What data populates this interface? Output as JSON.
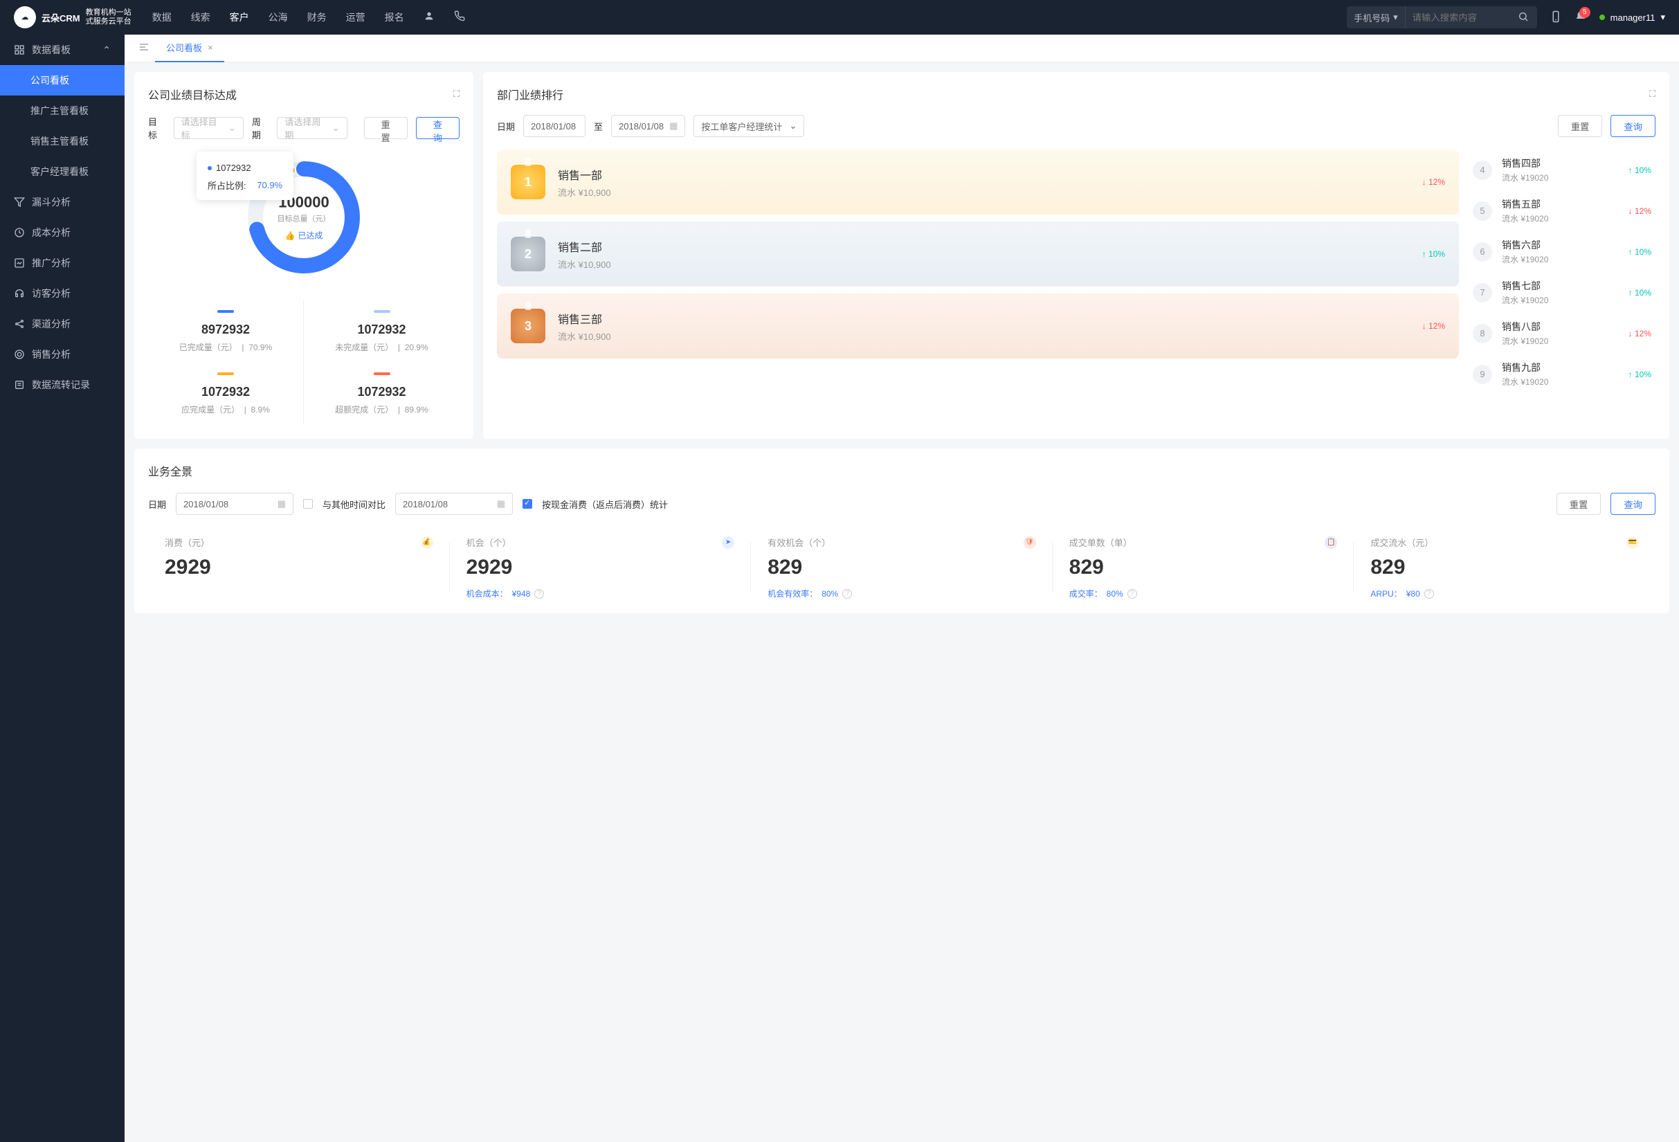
{
  "header": {
    "logo_main": "云朵CRM",
    "logo_sub1": "教育机构一站",
    "logo_sub2": "式服务云平台",
    "nav": [
      "数据",
      "线索",
      "客户",
      "公海",
      "财务",
      "运营",
      "报名"
    ],
    "nav_active": 2,
    "search_type": "手机号码",
    "search_placeholder": "请输入搜索内容",
    "notif_count": "5",
    "username": "manager11"
  },
  "sidebar": {
    "items": [
      {
        "label": "数据看板",
        "expandable": true,
        "expanded": true,
        "subs": [
          {
            "label": "公司看板",
            "active": true
          },
          {
            "label": "推广主管看板"
          },
          {
            "label": "销售主管看板"
          },
          {
            "label": "客户经理看板"
          }
        ]
      },
      {
        "label": "漏斗分析"
      },
      {
        "label": "成本分析"
      },
      {
        "label": "推广分析"
      },
      {
        "label": "访客分析"
      },
      {
        "label": "渠道分析"
      },
      {
        "label": "销售分析"
      },
      {
        "label": "数据流转记录"
      }
    ]
  },
  "tabs": {
    "active": "公司看板"
  },
  "goal": {
    "title": "公司业绩目标达成",
    "target_label": "目标",
    "target_placeholder": "请选择目标",
    "period_label": "周期",
    "period_placeholder": "请选择周期",
    "reset": "重置",
    "query": "查询",
    "tooltip_val": "1072932",
    "tooltip_ratio_lbl": "所占比例:",
    "tooltip_ratio_val": "70.9%",
    "center_val": "100000",
    "center_lbl": "目标总量（元）",
    "center_badge": "已达成",
    "stats": [
      {
        "color": "#3a7afe",
        "val": "8972932",
        "lbl": "已完成量（元）",
        "pct": "70.9%"
      },
      {
        "color": "#a8c8ff",
        "val": "1072932",
        "lbl": "未完成量（元）",
        "pct": "20.9%"
      },
      {
        "color": "#ffb020",
        "val": "1072932",
        "lbl": "应完成量（元）",
        "pct": "8.9%"
      },
      {
        "color": "#ff6b4d",
        "val": "1072932",
        "lbl": "超额完成（元）",
        "pct": "89.9%"
      }
    ]
  },
  "ranking": {
    "title": "部门业绩排行",
    "date_label": "日期",
    "date_from": "2018/01/08",
    "date_to": "2018/01/08",
    "date_sep": "至",
    "mode": "按工单客户经理统计",
    "reset": "重置",
    "query": "查询",
    "top": [
      {
        "medal": "gold",
        "num": "1",
        "name": "销售一部",
        "sub": "流水 ¥10,900",
        "pct": "12%",
        "dir": "down"
      },
      {
        "medal": "silver",
        "num": "2",
        "name": "销售二部",
        "sub": "流水 ¥10,900",
        "pct": "10%",
        "dir": "up"
      },
      {
        "medal": "bronze",
        "num": "3",
        "name": "销售三部",
        "sub": "流水 ¥10,900",
        "pct": "12%",
        "dir": "down"
      }
    ],
    "rest": [
      {
        "num": "4",
        "name": "销售四部",
        "sub": "流水 ¥19020",
        "pct": "10%",
        "dir": "up"
      },
      {
        "num": "5",
        "name": "销售五部",
        "sub": "流水 ¥19020",
        "pct": "12%",
        "dir": "down"
      },
      {
        "num": "6",
        "name": "销售六部",
        "sub": "流水 ¥19020",
        "pct": "10%",
        "dir": "up"
      },
      {
        "num": "7",
        "name": "销售七部",
        "sub": "流水 ¥19020",
        "pct": "10%",
        "dir": "up"
      },
      {
        "num": "8",
        "name": "销售八部",
        "sub": "流水 ¥19020",
        "pct": "12%",
        "dir": "down"
      },
      {
        "num": "9",
        "name": "销售九部",
        "sub": "流水 ¥19020",
        "pct": "10%",
        "dir": "up"
      }
    ]
  },
  "overview": {
    "title": "业务全景",
    "date_label": "日期",
    "date1": "2018/01/08",
    "compare_label": "与其他时间对比",
    "date2": "2018/01/08",
    "checkbox_label": "按现金消费（返点后消费）统计",
    "reset": "重置",
    "query": "查询",
    "kpis": [
      {
        "lbl": "消费（元）",
        "val": "2929",
        "icon_bg": "#fff3e0",
        "icon_fg": "#ffb020",
        "sub_lbl": "",
        "sub_val": ""
      },
      {
        "lbl": "机会（个）",
        "val": "2929",
        "icon_bg": "#e6f0ff",
        "icon_fg": "#3a7afe",
        "sub_lbl": "机会成本：",
        "sub_val": "¥948"
      },
      {
        "lbl": "有效机会（个）",
        "val": "829",
        "icon_bg": "#ffe8e0",
        "icon_fg": "#ff6b4d",
        "sub_lbl": "机会有效率：",
        "sub_val": "80%"
      },
      {
        "lbl": "成交单数（单）",
        "val": "829",
        "icon_bg": "#e8eaff",
        "icon_fg": "#6b6bff",
        "sub_lbl": "成交率：",
        "sub_val": "80%"
      },
      {
        "lbl": "成交流水（元）",
        "val": "829",
        "icon_bg": "#fff3e0",
        "icon_fg": "#ffb020",
        "sub_lbl": "ARPU：",
        "sub_val": "¥80"
      }
    ]
  },
  "chart_data": {
    "type": "pie",
    "title": "公司业绩目标达成",
    "total": 100000,
    "total_label": "目标总量（元）",
    "series": [
      {
        "name": "已完成量（元）",
        "value": 8972932,
        "pct": 70.9,
        "color": "#3a7afe"
      },
      {
        "name": "未完成量（元）",
        "value": 1072932,
        "pct": 20.9,
        "color": "#a8c8ff"
      },
      {
        "name": "应完成量（元）",
        "value": 1072932,
        "pct": 8.9,
        "color": "#ffb020"
      },
      {
        "name": "超额完成（元）",
        "value": 1072932,
        "pct": 89.9,
        "color": "#ff6b4d"
      }
    ],
    "tooltip": {
      "value": 1072932,
      "ratio": 70.9
    }
  }
}
